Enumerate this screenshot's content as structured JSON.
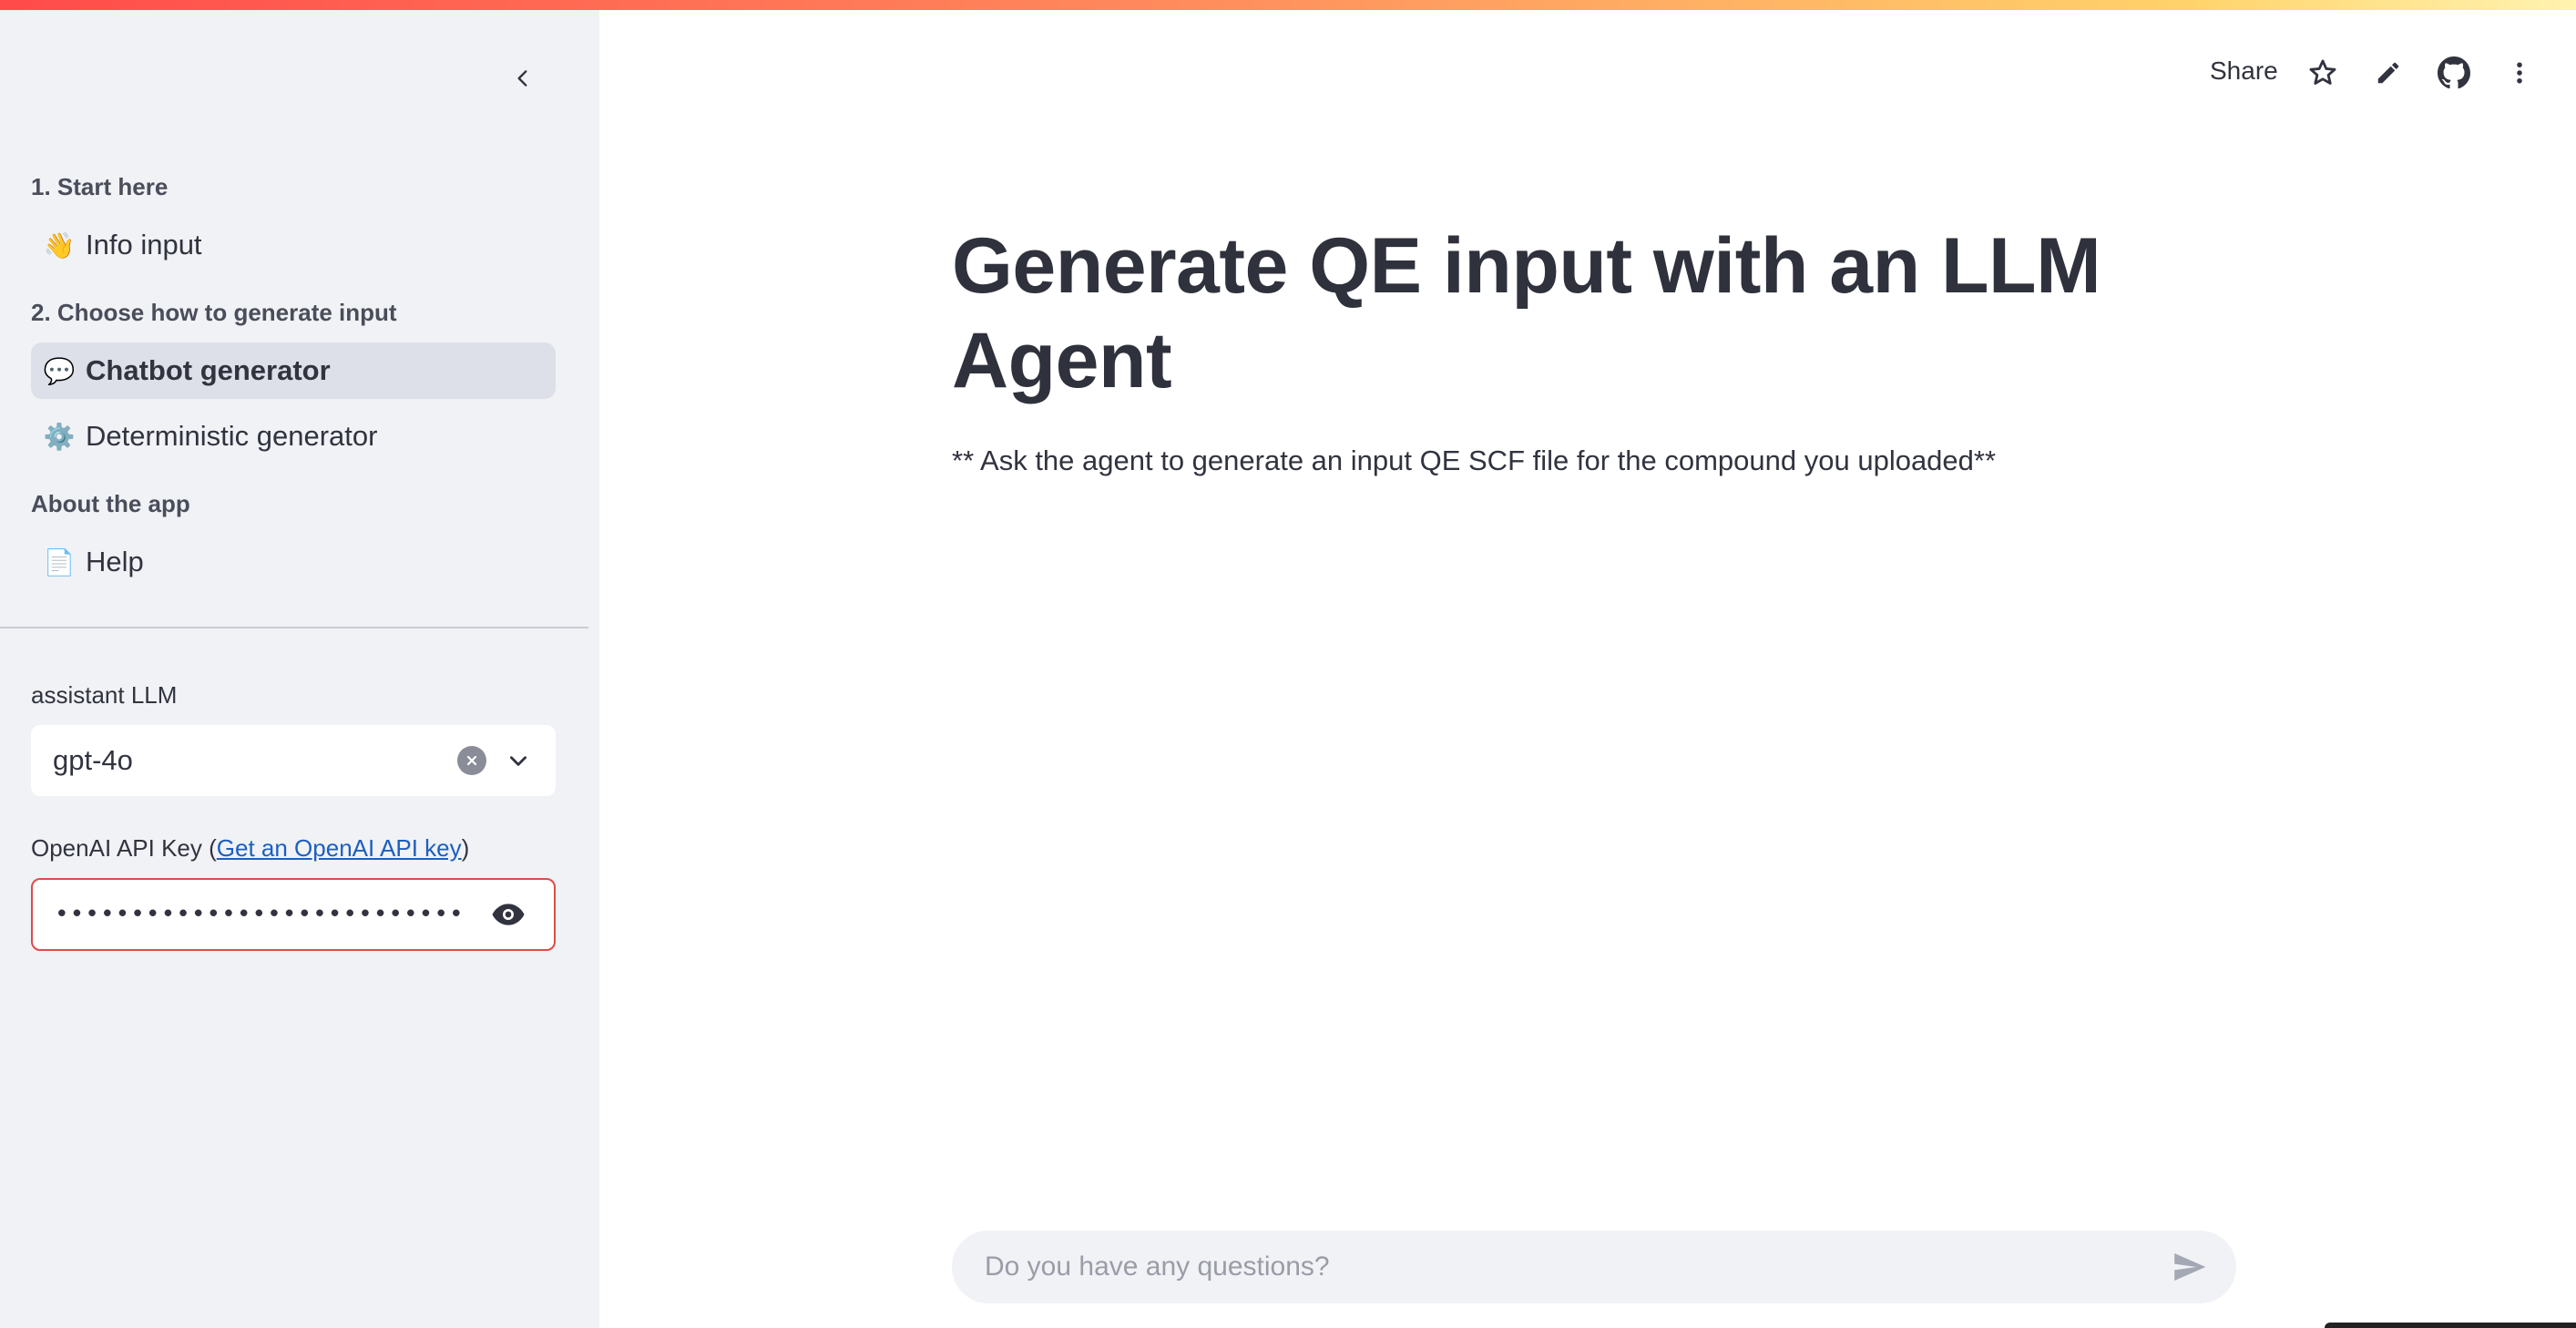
{
  "sidebar": {
    "sections": [
      {
        "heading": "1. Start here",
        "items": [
          {
            "icon": "waving-hand-icon",
            "emoji": "👋",
            "label": "Info input"
          }
        ]
      },
      {
        "heading": "2. Choose how to generate input",
        "items": [
          {
            "icon": "speech-balloon-icon",
            "emoji": "💬",
            "label": "Chatbot generator",
            "active": true
          },
          {
            "icon": "gear-icon",
            "emoji": "⚙️",
            "label": "Deterministic generator"
          }
        ]
      },
      {
        "heading": "About the app",
        "items": [
          {
            "icon": "page-icon",
            "emoji": "📄",
            "label": "Help"
          }
        ]
      }
    ],
    "llm_select": {
      "label": "assistant LLM",
      "value": "gpt-4o"
    },
    "api_key": {
      "label_prefix": "OpenAI API Key (",
      "link_text": "Get an OpenAI API key",
      "label_suffix": ")",
      "masked_value": "••••••••••••••••••••••••••••••••••••••••••••••••••••"
    }
  },
  "header": {
    "share_label": "Share",
    "icons": [
      "star-icon",
      "pencil-icon",
      "github-icon",
      "more-vertical-icon"
    ]
  },
  "main": {
    "title": "Generate QE input with an LLM Agent",
    "subtitle": "** Ask the agent to generate an input QE SCF file for the compound you uploaded**",
    "chat_placeholder": "Do you have any questions?"
  },
  "colors": {
    "sidebar_bg": "#f0f2f6",
    "active_item_bg": "#dde0e8",
    "text": "#31333f",
    "link": "#1d5fbf",
    "error_border": "#e04a48"
  }
}
